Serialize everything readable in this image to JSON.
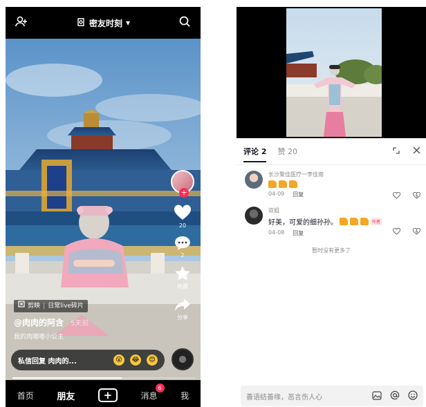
{
  "left_screen": {
    "topbar": {
      "title": "密友时刻"
    },
    "right_rail": {
      "like_count": "20",
      "comment_count": "2",
      "favorite_label": "收藏",
      "share_label": "分享"
    },
    "capcut_tag": {
      "brand": "剪映",
      "divider": "|",
      "text": "日常live碎片"
    },
    "author": "@肉肉的阿含",
    "post_time": "5天前",
    "caption": "我的肉嘟嘟小公主",
    "dm_bar": {
      "text": "私信回复 肉肉的..."
    },
    "progress": 0.6,
    "bottom_nav": {
      "home": "首页",
      "friends": "朋友",
      "plus": "+",
      "messages": "消息",
      "messages_badge": "6",
      "me": "我"
    }
  },
  "right_screen": {
    "tabs": {
      "comments": "评论 2",
      "likes": "赞 20"
    },
    "comments": [
      {
        "name": "长沙聚佳医疗一李佳南",
        "date": "04-09",
        "reply": "回复"
      },
      {
        "name": "双姐",
        "text": "好美，可爱的细孙孙。",
        "author_tag": "作者",
        "date": "04-08",
        "reply": "回复"
      }
    ],
    "no_more": "暂时没有更多了",
    "input_placeholder": "善语结善缘，恶言伤人心"
  },
  "colors": {
    "accent": "#fe2c55",
    "thumb": "#f5a623"
  }
}
